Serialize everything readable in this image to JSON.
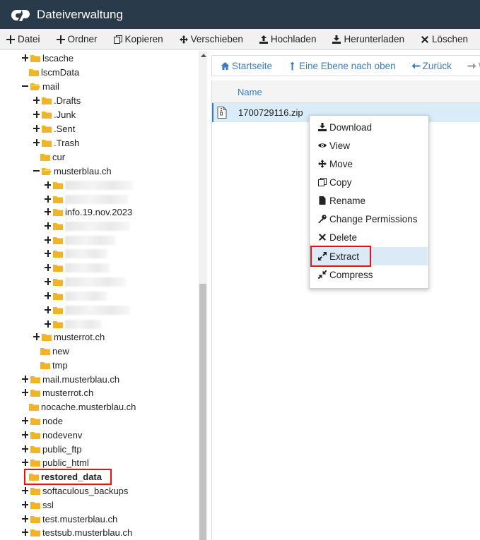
{
  "header": {
    "title": "Dateiverwaltung"
  },
  "toolbar": {
    "file": "Datei",
    "folder": "Ordner",
    "copy": "Kopieren",
    "move": "Verschieben",
    "upload": "Hochladen",
    "download": "Herunterladen",
    "delete": "Löschen"
  },
  "nav": {
    "home": "Startseite",
    "up": "Eine Ebene nach oben",
    "back": "Zurück",
    "forward": "We"
  },
  "list": {
    "column_name": "Name",
    "file_name": "1700729116.zip"
  },
  "context_menu": {
    "download": "Download",
    "view": "View",
    "move": "Move",
    "copy": "Copy",
    "rename": "Rename",
    "permissions": "Change Permissions",
    "delete": "Delete",
    "extract": "Extract",
    "compress": "Compress"
  },
  "tree": {
    "lscache": "lscache",
    "lscmdata": "lscmData",
    "mail": "mail",
    "drafts": ".Drafts",
    "junk": ".Junk",
    "sent": ".Sent",
    "trash": ".Trash",
    "cur": "cur",
    "musterblau": "musterblau.ch",
    "info": "info.19.nov.2023",
    "musterrot_inner": "musterrot.ch",
    "new": "new",
    "tmp": "tmp",
    "mail_musterblau": "mail.musterblau.ch",
    "musterrot": "musterrot.ch",
    "nocache": "nocache.musterblau.ch",
    "node": "node",
    "nodevenv": "nodevenv",
    "public_ftp": "public_ftp",
    "public_html": "public_html",
    "restored_data": "restored_data",
    "softaculous": "softaculous_backups",
    "ssl": "ssl",
    "test": "test.musterblau.ch",
    "testsub": "testsub.musterblau.ch"
  },
  "colors": {
    "header_bg": "#293a4a",
    "link": "#3b7bbf",
    "folder": "#f0b429",
    "highlight": "#e11111",
    "selected_row": "#d9ecf7"
  },
  "icons": [
    "cpanel-logo",
    "plus-icon",
    "copy-icon",
    "move-icon",
    "upload-icon",
    "download-icon",
    "close-icon",
    "home-icon",
    "level-up-icon",
    "back-arrow-icon",
    "forward-arrow-icon",
    "zip-file-icon",
    "eye-icon",
    "file-icon",
    "key-icon",
    "expand-icon",
    "compress-icon",
    "folder-icon",
    "folder-open-icon"
  ]
}
